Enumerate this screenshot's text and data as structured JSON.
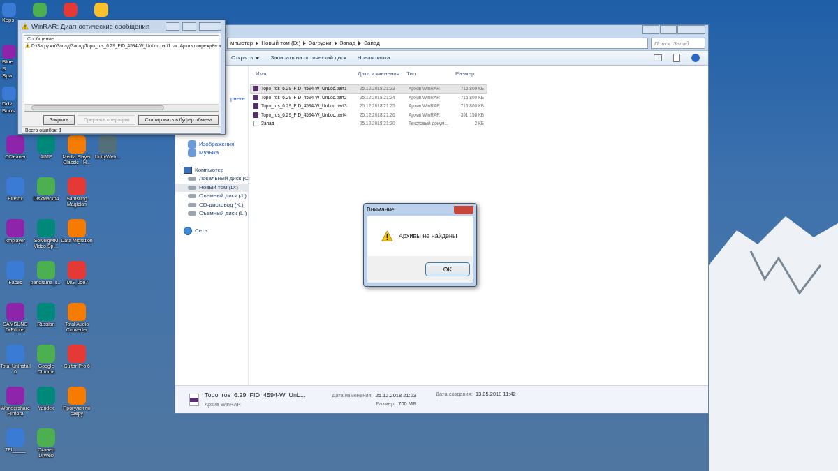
{
  "desktop_icon_rows": [
    [
      {
        "label": "Корз",
        "kind": "clipped"
      },
      {
        "kind": "clipped"
      },
      {
        "kind": "clipped"
      },
      {
        "kind": "clipped"
      }
    ],
    [
      {
        "label": "BlueS Spa",
        "kind": "clipped"
      }
    ],
    [
      {
        "label": "Driv Boos",
        "kind": "clipped"
      }
    ],
    [
      {
        "label": "CCleaner",
        "kind": "app"
      },
      {
        "label": "AIMP",
        "kind": "app"
      },
      {
        "label": "Media Player Classic - H...",
        "kind": "app"
      },
      {
        "label": "UnityWeb...",
        "kind": "app"
      }
    ],
    [
      {
        "label": "Firefox",
        "kind": "app"
      },
      {
        "label": "DiskMark64",
        "kind": "app"
      },
      {
        "label": "Samsung Magician",
        "kind": "app"
      }
    ],
    [
      {
        "label": "kmplayer",
        "kind": "app"
      },
      {
        "label": "SolveigMM Video Spl...",
        "kind": "app"
      },
      {
        "label": "Data Migration",
        "kind": "app"
      }
    ],
    [
      {
        "label": "Faces",
        "kind": "app"
      },
      {
        "label": "panorama_s...",
        "kind": "app"
      },
      {
        "label": "IMG_0597",
        "kind": "app"
      }
    ],
    [
      {
        "label": "SAMSUNG DrPrinter",
        "kind": "app"
      },
      {
        "label": "Russian",
        "kind": "app"
      },
      {
        "label": "Total Audio Converter",
        "kind": "app"
      }
    ],
    [
      {
        "label": "Total Uninstall 6",
        "kind": "app"
      },
      {
        "label": "Google Chrome",
        "kind": "app"
      },
      {
        "label": "Guitar Pro 6",
        "kind": "app"
      }
    ],
    [
      {
        "label": "Wondershare Filmora",
        "kind": "app"
      },
      {
        "label": "Yandex",
        "kind": "app"
      },
      {
        "label": "Прогулки по озеру",
        "kind": "app"
      }
    ],
    [
      {
        "label": "TFI_____",
        "kind": "app"
      },
      {
        "label": "Сканер DrWeb",
        "kind": "app"
      }
    ]
  ],
  "explorer": {
    "address": [
      "мпьютер",
      "Новый том (D:)",
      "Загрузки",
      "Запад",
      "Запад"
    ],
    "search": {
      "placeholder": "Поиск: Запад"
    },
    "toolbar": [
      {
        "label": "Открыть",
        "dropdown": true
      },
      {
        "label": "Записать на оптический диск",
        "dropdown": false
      },
      {
        "label": "Новая папка",
        "dropdown": false
      }
    ],
    "sidebar": [
      {
        "label": "рнете",
        "kind": "link",
        "selected": false
      },
      {
        "label": "Изображения",
        "kind": "library",
        "selected": false
      },
      {
        "label": "Музыка",
        "kind": "library",
        "selected": false
      },
      {
        "label": "Компьютер",
        "kind": "computer",
        "selected": false
      },
      {
        "label": "Локальный диск (C:",
        "kind": "drive",
        "selected": false
      },
      {
        "label": "Новый том (D:)",
        "kind": "drive",
        "selected": true
      },
      {
        "label": "Съемный диск (J:)",
        "kind": "drive",
        "selected": false
      },
      {
        "label": "CD-дисковод (K:)",
        "kind": "drive",
        "selected": false
      },
      {
        "label": "Съемный диск (L:)",
        "kind": "drive",
        "selected": false
      },
      {
        "label": "Сеть",
        "kind": "network",
        "selected": false
      }
    ],
    "columns": [
      "Имя",
      "Дата изменения",
      "Тип",
      "Размер"
    ],
    "rows": [
      {
        "name": "Topo_ros_6.29_FID_4594-W_UnLoc.part1",
        "date": "25.12.2018 21:23",
        "type": "Архив WinRAR",
        "size": "716 800 КБ",
        "kind": "archive",
        "selected": true
      },
      {
        "name": "Topo_ros_6.29_FID_4594-W_UnLoc.part2",
        "date": "25.12.2018 21:24",
        "type": "Архив WinRAR",
        "size": "716 800 КБ",
        "kind": "archive",
        "selected": false
      },
      {
        "name": "Topo_ros_6.29_FID_4594-W_UnLoc.part3",
        "date": "25.12.2018 21:25",
        "type": "Архив WinRAR",
        "size": "716 800 КБ",
        "kind": "archive",
        "selected": false
      },
      {
        "name": "Topo_ros_6.29_FID_4594-W_UnLoc.part4",
        "date": "25.12.2018 21:26",
        "type": "Архив WinRAR",
        "size": "391 156 КБ",
        "kind": "archive",
        "selected": false
      },
      {
        "name": "Запад",
        "date": "25.12.2018 21:20",
        "type": "Текстовый докум...",
        "size": "2 КБ",
        "kind": "text",
        "selected": false
      }
    ],
    "details": {
      "name": "Topo_ros_6.29_FID_4594-W_UnL...",
      "type": "Архив WinRAR",
      "fields": [
        {
          "label": "Дата изменения:",
          "value": "25.12.2018 21:23"
        },
        {
          "label": "Размер:",
          "value": "700 МБ"
        },
        {
          "label": "Дата создания:",
          "value": "13.05.2019 11:42"
        }
      ]
    }
  },
  "winrar": {
    "title": "WinRAR: Диагностические сообщения",
    "column": "Сообщение",
    "messages": [
      "D:\\Загрузки\\Запад\\Запад\\Topo_ros_6.29_FID_4594-W_UnLoc.part1.rar: Архив повреждён и"
    ],
    "buttons": [
      {
        "label": "Закрыть",
        "disabled": false
      },
      {
        "label": "Прервать операцию",
        "disabled": true
      },
      {
        "label": "Скопировать в буфер обмена",
        "disabled": false
      }
    ],
    "status": "Всего ошибок: 1"
  },
  "alert": {
    "title": "Внимание",
    "message": "Архивы не найдены",
    "button": "OK"
  }
}
